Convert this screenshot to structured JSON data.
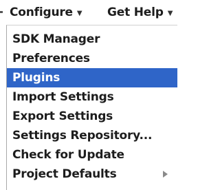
{
  "menubar": {
    "configure": {
      "label": "Configure",
      "caret_icon": "chevron-down-icon"
    },
    "get_help": {
      "label": "Get Help",
      "caret_icon": "chevron-down-icon"
    }
  },
  "dropdown": {
    "items": [
      {
        "label": "SDK Manager",
        "selected": false
      },
      {
        "label": "Preferences",
        "selected": false
      },
      {
        "label": "Plugins",
        "selected": true
      },
      {
        "label": "Import Settings",
        "selected": false
      },
      {
        "label": "Export Settings",
        "selected": false
      },
      {
        "label": "Settings Repository...",
        "selected": false
      },
      {
        "label": "Check for Update",
        "selected": false
      },
      {
        "label": "Project Defaults",
        "selected": false,
        "has_submenu": true,
        "submenu_icon": "chevron-right-icon"
      }
    ]
  },
  "colors": {
    "selection": "#2f65c8",
    "text": "#1d1d1d",
    "selected_text": "#ffffff"
  }
}
